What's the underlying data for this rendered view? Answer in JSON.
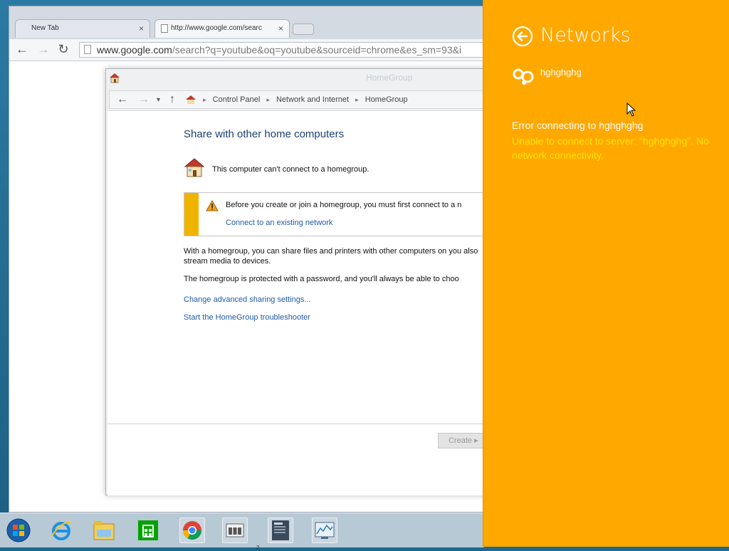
{
  "browser": {
    "tabs": [
      {
        "title": "New Tab"
      },
      {
        "title": "http://www.google.com/searc"
      }
    ],
    "address": {
      "host": "www.google.com",
      "path": "/search?q=youtube&oq=youtube&sourceid=chrome&es_sm=93&i"
    }
  },
  "homegroup": {
    "window_title": "HomeGroup",
    "breadcrumb": [
      "Control Panel",
      "Network and Internet",
      "HomeGroup"
    ],
    "heading": "Share with other home computers",
    "status": "This computer can't connect to a homegroup.",
    "warning_text": "Before you create or join a homegroup, you must first connect to a n",
    "warning_link": "Connect to an existing network",
    "paragraph1": "With a homegroup, you can share files and printers with other computers on you also stream media to devices.",
    "paragraph2": "The homegroup is protected with a password, and you'll always be able to choo",
    "link_advanced": "Change advanced sharing settings...",
    "link_troubleshooter": "Start the HomeGroup troubleshooter",
    "create_button": "Create ▸"
  },
  "taskbar": {
    "items": [
      "start-button",
      "internet-explorer",
      "file-explorer",
      "store",
      "chrome",
      "homegroup",
      "document",
      "resource-monitor"
    ],
    "badge": "2"
  },
  "networks_panel": {
    "title": "Networks",
    "network_name": "hghghghg",
    "error_title": "Error connecting to hghghghg",
    "error_detail": "Unable to connect to server: \"hghghghg\". No network connectivity.",
    "colors": {
      "background": "#ffa800",
      "error_detail": "#ffe400",
      "text": "#ffffff"
    }
  }
}
